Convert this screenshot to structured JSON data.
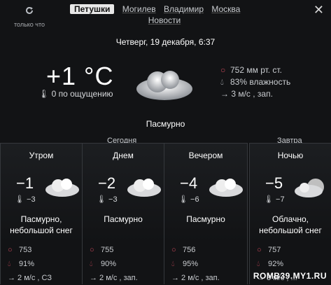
{
  "topbar": {
    "refresh_label": "только что",
    "cities": [
      "Петушки",
      "Могилев",
      "Владимир",
      "Москва"
    ],
    "news_label": "Новости"
  },
  "date": "Четверг, 19 декабря, 6:37",
  "current": {
    "temp": "+1 °C",
    "feels_like": "0 по ощущению",
    "pressure": "752 мм рт. ст.",
    "humidity": "83% влажность",
    "wind": "→ 3 м/с , зап.",
    "condition": "Пасмурно"
  },
  "sections": {
    "today": "Сегодня",
    "tomorrow": "Завтра"
  },
  "periods": [
    {
      "title": "Утром",
      "temp": "−1",
      "feels": "−3",
      "condition": "Пасмурно,\nнебольшой снег",
      "pressure": "753",
      "humidity": "91%",
      "wind": "→ 2 м/с , СЗ"
    },
    {
      "title": "Днем",
      "temp": "−2",
      "feels": "−3",
      "condition": "Пасмурно",
      "pressure": "755",
      "humidity": "90%",
      "wind": "→ 2 м/с , зап."
    },
    {
      "title": "Вечером",
      "temp": "−4",
      "feels": "−6",
      "condition": "Пасмурно",
      "pressure": "756",
      "humidity": "95%",
      "wind": "→ 2 м/с , зап."
    },
    {
      "title": "Ночью",
      "temp": "−5",
      "feels": "−7",
      "condition": "Облачно,\nнебольшой снег",
      "pressure": "757",
      "humidity": "92%",
      "wind": "→ 3 м/с , ..."
    }
  ],
  "watermark": "ROMB39.MY1.RU",
  "colors": {
    "background": "#121315",
    "accent": "#c9485a"
  }
}
